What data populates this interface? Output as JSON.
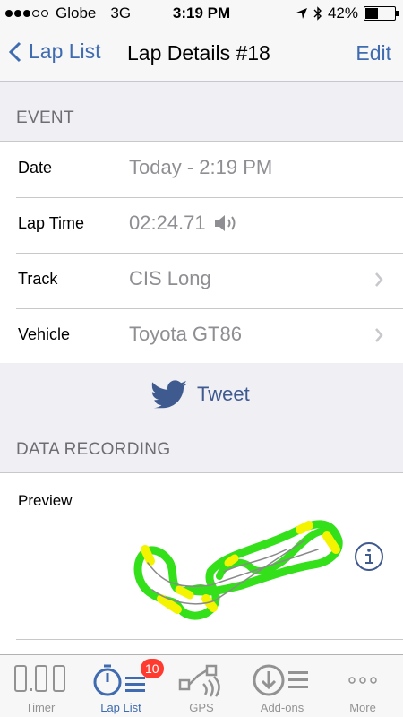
{
  "status_bar": {
    "carrier": "Globe",
    "network": "3G",
    "time": "3:19 PM",
    "battery": "42%",
    "signal_bars_filled": 3,
    "signal_bars_total": 5,
    "battery_level": 0.42
  },
  "nav": {
    "back_label": "Lap List",
    "title": "Lap Details #18",
    "edit_label": "Edit"
  },
  "event": {
    "header": "EVENT",
    "rows": [
      {
        "label": "Date",
        "value": "Today - 2:19 PM"
      },
      {
        "label": "Lap Time",
        "value": "02:24.71"
      },
      {
        "label": "Track",
        "value": "CIS Long"
      },
      {
        "label": "Vehicle",
        "value": "Toyota GT86"
      }
    ],
    "tweet_label": "Tweet"
  },
  "data_recording": {
    "header": "DATA RECORDING",
    "preview_label": "Preview"
  },
  "tabs": [
    {
      "label": "Timer",
      "icon": "timer-digits-icon"
    },
    {
      "label": "Lap List",
      "icon": "stopwatch-list-icon",
      "badge": "10"
    },
    {
      "label": "GPS",
      "icon": "gps-signal-icon"
    },
    {
      "label": "Add-ons",
      "icon": "download-list-icon"
    },
    {
      "label": "More",
      "icon": "more-dots-icon"
    }
  ],
  "colors": {
    "accent": "#3f6bb0",
    "badge": "#ff3b30",
    "track_green": "#33e01a",
    "track_yellow": "#f4f400"
  }
}
